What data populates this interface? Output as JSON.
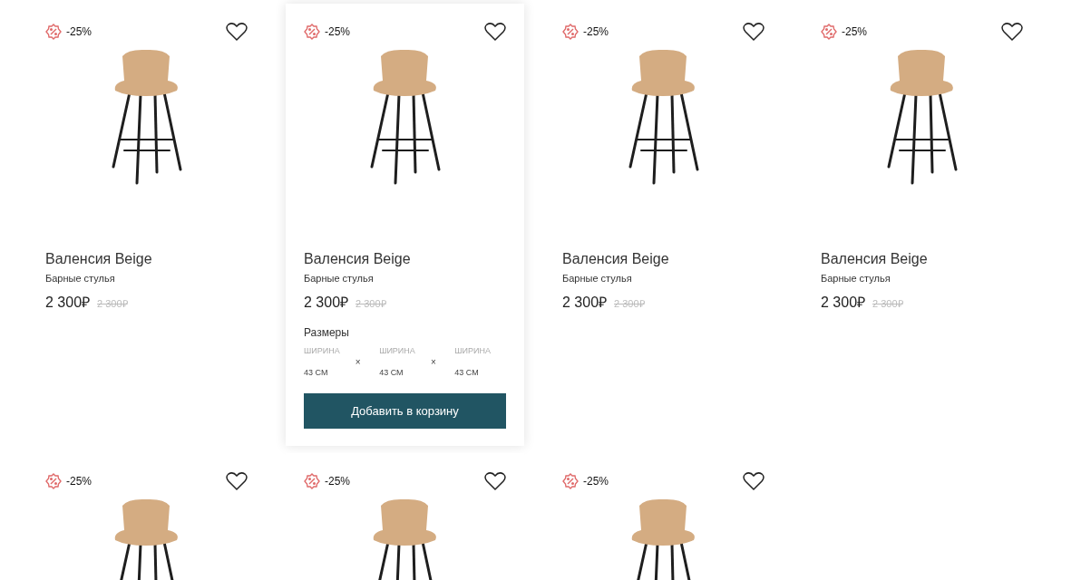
{
  "products": [
    {
      "discount": "-25%",
      "favorite": false,
      "expanded": false,
      "name": "Валенсия Beige",
      "category": "Барные стулья",
      "price": "2 300₽",
      "old_price": "2 300₽"
    },
    {
      "discount": "-25%",
      "favorite": false,
      "expanded": true,
      "name": "Валенсия Beige",
      "category": "Барные стулья",
      "price": "2 300₽",
      "old_price": "2 300₽",
      "sizes_title": "Размеры",
      "sizes": [
        {
          "label": "ШИРИНА",
          "value": "43 СМ"
        },
        {
          "label": "ШИРИНА",
          "value": "43 СМ"
        },
        {
          "label": "ШИРИНА",
          "value": "43 СМ"
        }
      ],
      "separator": "×",
      "button": "Добавить в корзину"
    },
    {
      "discount": "-25%",
      "favorite": false,
      "expanded": false,
      "name": "Валенсия Beige",
      "category": "Барные стулья",
      "price": "2 300₽",
      "old_price": "2 300₽"
    },
    {
      "discount": "-25%",
      "favorite": false,
      "expanded": false,
      "name": "Валенсия Beige",
      "category": "Барные стулья",
      "price": "2 300₽",
      "old_price": "2 300₽"
    },
    {
      "discount": "-25%",
      "favorite": false,
      "expanded": false
    },
    {
      "discount": "-25%",
      "favorite": false,
      "expanded": false
    },
    {
      "discount": "-25%",
      "favorite": false,
      "expanded": false
    }
  ]
}
